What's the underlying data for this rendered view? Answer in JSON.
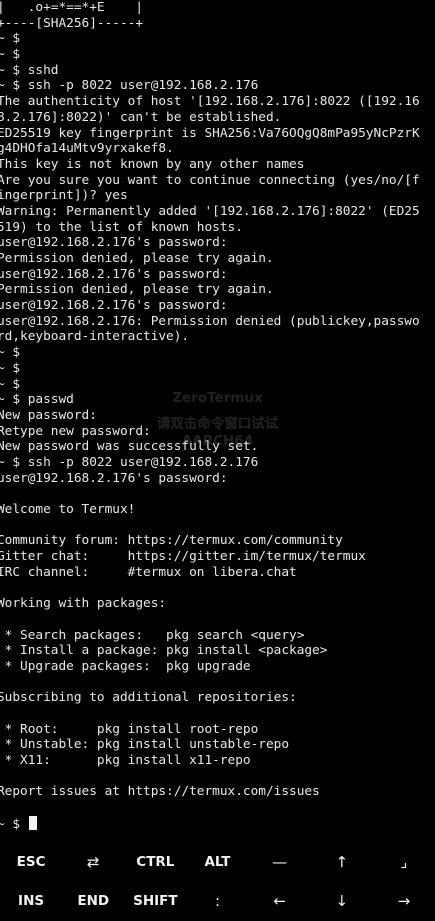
{
  "terminal": {
    "lines": [
      "|   .o+=*==*+E    |",
      "+----[SHA256]-----+",
      "~ $",
      "~ $",
      "~ $ sshd",
      "~ $ ssh -p 8022 user@192.168.2.176",
      "The authenticity of host '[192.168.2.176]:8022 ([192.16",
      "8.2.176]:8022)' can't be established.",
      "ED25519 key fingerprint is SHA256:Va76OQgQ8mPa95yNcPzrK",
      "g4DHOfa14uMtv9yrxakef8.",
      "This key is not known by any other names",
      "Are you sure you want to continue connecting (yes/no/[f",
      "ingerprint])? yes",
      "Warning: Permanently added '[192.168.2.176]:8022' (ED25",
      "519) to the list of known hosts.",
      "user@192.168.2.176's password:",
      "Permission denied, please try again.",
      "user@192.168.2.176's password:",
      "Permission denied, please try again.",
      "user@192.168.2.176's password:",
      "user@192.168.2.176: Permission denied (publickey,passwo",
      "rd,keyboard-interactive).",
      "~ $",
      "~ $",
      "~ $",
      "~ $ passwd",
      "New password:",
      "Retype new password:",
      "New password was successfully set.",
      "~ $ ssh -p 8022 user@192.168.2.176",
      "user@192.168.2.176's password:",
      "",
      "Welcome to Termux!",
      "",
      "Community forum: https://termux.com/community",
      "Gitter chat:     https://gitter.im/termux/termux",
      "IRC channel:     #termux on libera.chat",
      "",
      "Working with packages:",
      "",
      " * Search packages:   pkg search <query>",
      " * Install a package: pkg install <package>",
      " * Upgrade packages:  pkg upgrade",
      "",
      "Subscribing to additional repositories:",
      "",
      " * Root:     pkg install root-repo",
      " * Unstable: pkg install unstable-repo",
      " * X11:      pkg install x11-repo",
      "",
      "Report issues at https://termux.com/issues",
      ""
    ],
    "current_prompt": "~ $ "
  },
  "watermark": {
    "line1": "ZeroTermux",
    "line2": "请双击命令窗口试试",
    "line3": "AARCH64"
  },
  "extra_keys": {
    "row1": [
      {
        "label": "ESC",
        "name": "esc-key"
      },
      {
        "label": "⇄",
        "name": "tab-key"
      },
      {
        "label": "CTRL",
        "name": "ctrl-key"
      },
      {
        "label": "ALT",
        "name": "alt-key"
      },
      {
        "label": "—",
        "name": "dash-key"
      },
      {
        "label": "↑",
        "name": "arrow-up-key"
      },
      {
        "label": "⌟",
        "name": "pipe-key"
      }
    ],
    "row2": [
      {
        "label": "INS",
        "name": "ins-key"
      },
      {
        "label": "END",
        "name": "end-key"
      },
      {
        "label": "SHIFT",
        "name": "shift-key"
      },
      {
        "label": ":",
        "name": "colon-key"
      },
      {
        "label": "←",
        "name": "arrow-left-key"
      },
      {
        "label": "↓",
        "name": "arrow-down-key"
      },
      {
        "label": "→",
        "name": "arrow-right-key"
      }
    ]
  }
}
